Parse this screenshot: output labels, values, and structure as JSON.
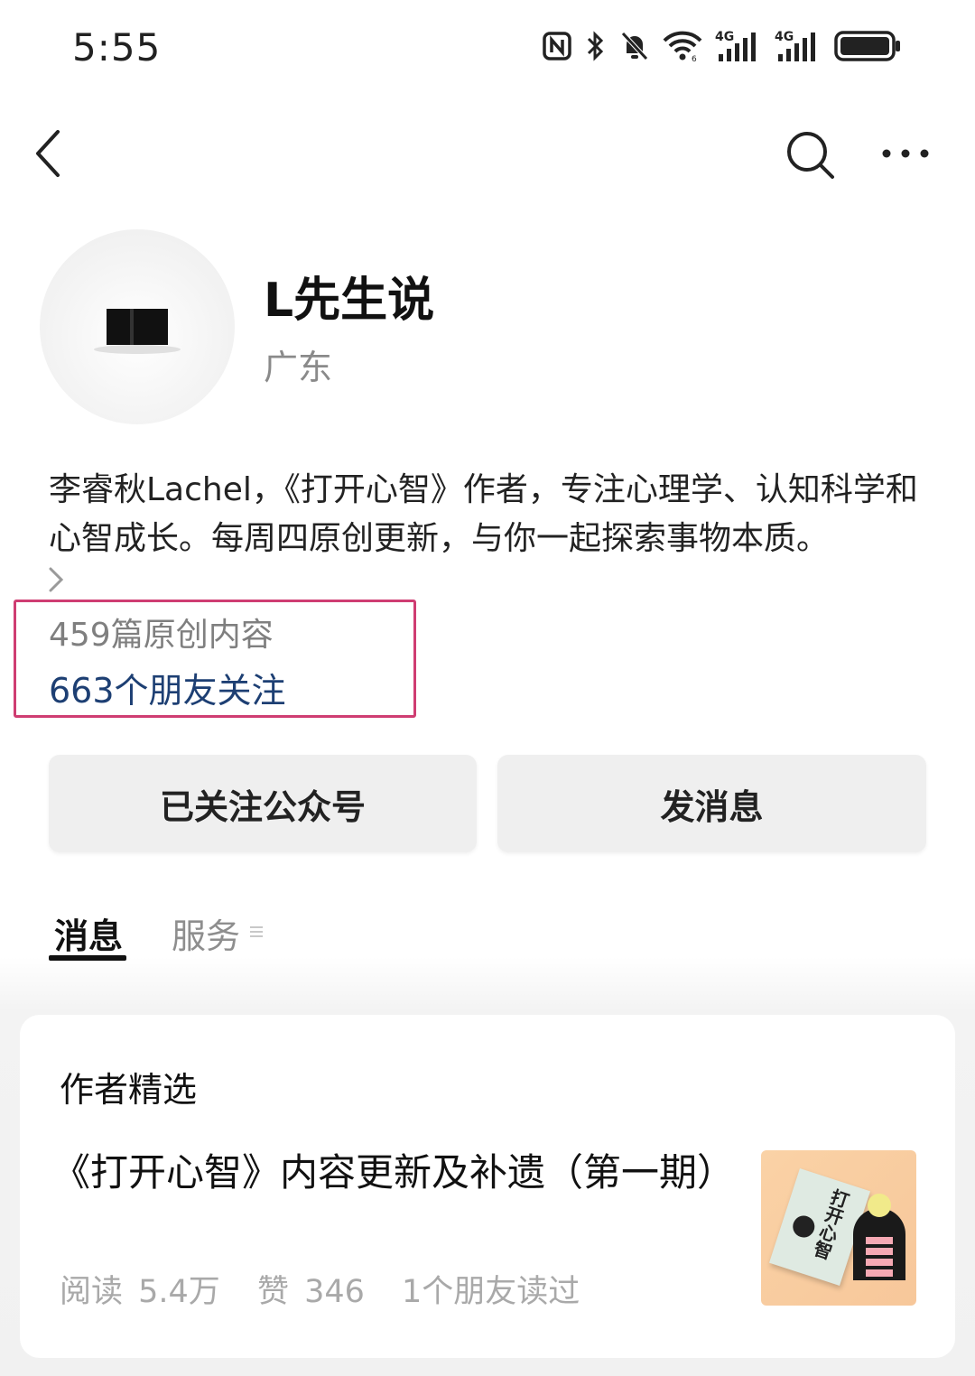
{
  "status_bar": {
    "time": "5:55",
    "icons": [
      "nfc-icon",
      "bluetooth-icon",
      "mute-bell-icon",
      "wifi-icon",
      "signal-4g-icon",
      "signal-4g-icon",
      "battery-icon"
    ],
    "signal_labels": [
      "4G",
      "4G"
    ]
  },
  "nav": {
    "icons": [
      "back-arrow-icon",
      "search-icon",
      "more-icon"
    ]
  },
  "profile": {
    "name": "L先生说",
    "location": "广东",
    "bio": "李睿秋Lachel，《打开心智》作者，专注心理学、认知科学和心智成长。每周四原创更新，与你一起探索事物本质。",
    "original_count": "459篇原创内容",
    "friends_following": "663个朋友关注"
  },
  "actions": {
    "follow_label": "已关注公众号",
    "message_label": "发消息"
  },
  "tabs": [
    {
      "label": "消息",
      "active": true
    },
    {
      "label": "服务",
      "active": false
    }
  ],
  "featured": {
    "section_title": "作者精选",
    "article": {
      "title": "《打开心智》内容更新及补遗（第一期）",
      "reads": "阅读 5.4万",
      "likes": "赞 346",
      "friends_read": "1个朋友读过",
      "thumbnail_text": "打开心智"
    }
  },
  "colors": {
    "highlight_border": "#cf3d72",
    "link_blue": "#1d3f73",
    "muted_text": "#8a8a8a",
    "button_bg": "#efefef"
  }
}
